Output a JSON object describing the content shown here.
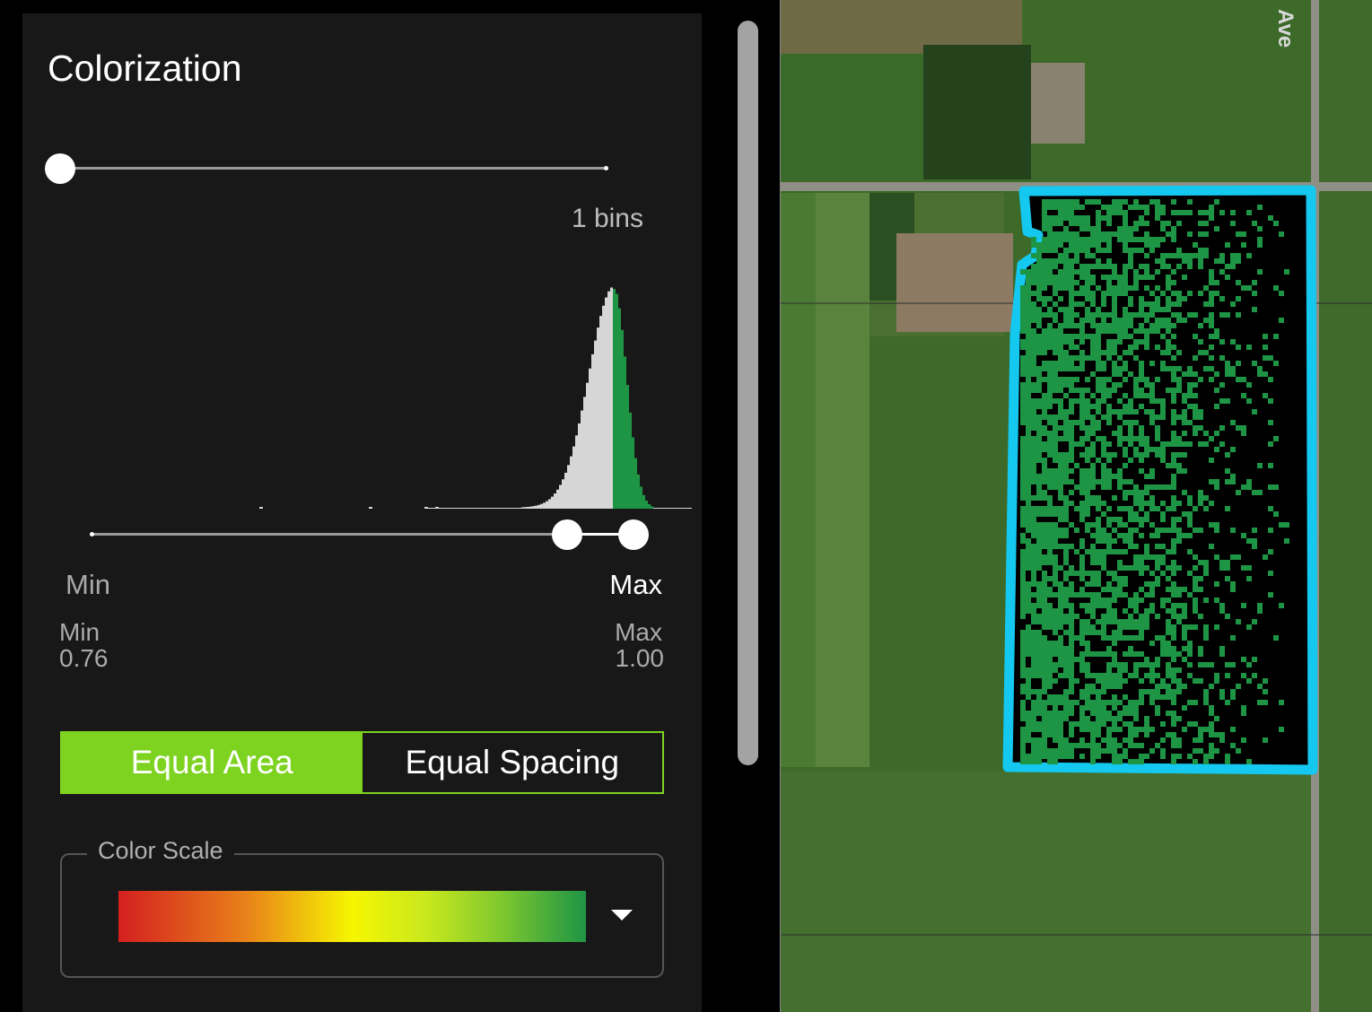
{
  "panel": {
    "title": "Colorization",
    "bins_label": "1 bins",
    "min_label": "Min",
    "max_label": "Max",
    "min_value_label": "Min",
    "min_value": "0.76",
    "max_value_label": "Max",
    "max_value": "1.00",
    "mode_equal_area": "Equal Area",
    "mode_equal_spacing": "Equal Spacing",
    "active_mode": "Equal Area",
    "color_scale_legend": "Color Scale",
    "color_scale_stops": [
      "#d42020",
      "#e8801a",
      "#f6f600",
      "#c8e81e",
      "#7ec82e",
      "#1e9445"
    ],
    "bins_slider_value": 1,
    "range_slider_low_fraction": 0.87,
    "range_slider_high_fraction": 1.0
  },
  "map": {
    "field_outline_color": "#14c8f0",
    "field_fill_color": "#1e9445"
  },
  "colors": {
    "accent": "#7ed321",
    "histogram_gray": "#d6d6d6",
    "histogram_green": "#1e9445"
  }
}
